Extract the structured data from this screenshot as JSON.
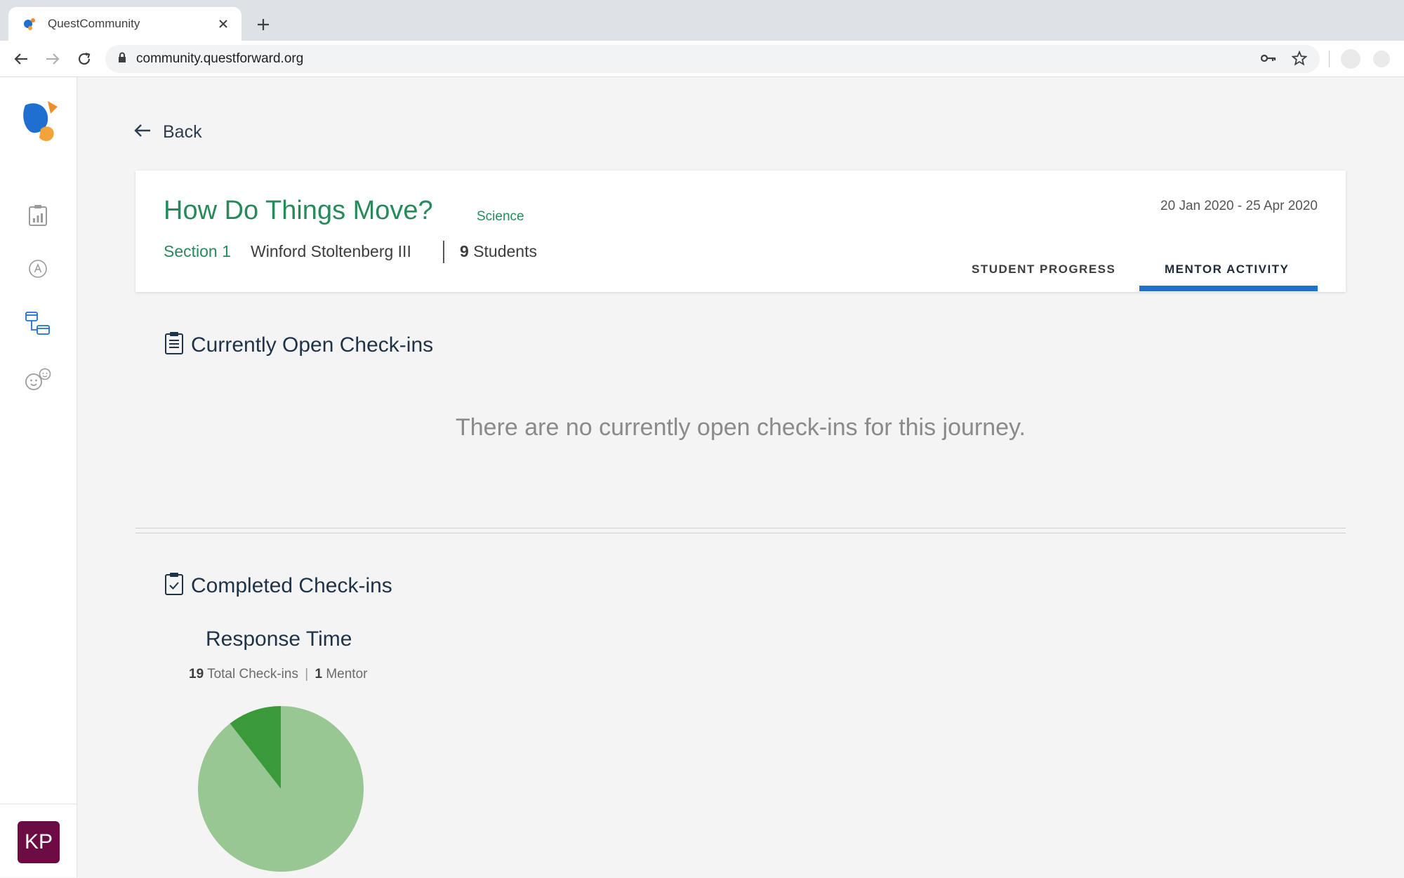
{
  "browser": {
    "tab_title": "QuestCommunity",
    "url": "community.questforward.org"
  },
  "sidebar": {
    "avatar_initials": "KP",
    "items": [
      {
        "icon": "report-icon"
      },
      {
        "icon": "badge-a-icon"
      },
      {
        "icon": "journeys-icon"
      },
      {
        "icon": "community-faces-icon"
      }
    ]
  },
  "page": {
    "back_label": "Back",
    "journey": {
      "title": "How Do Things Move?",
      "subject": "Science",
      "section": "Section 1",
      "teacher": "Winford Stoltenberg III",
      "students_count": "9",
      "students_label": "Students",
      "date_range": "20 Jan 2020 - 25 Apr 2020"
    },
    "tabs": [
      {
        "label": "STUDENT PROGRESS",
        "active": false
      },
      {
        "label": "MENTOR ACTIVITY",
        "active": true
      }
    ],
    "open_checkins": {
      "heading": "Currently Open Check-ins",
      "empty_message": "There are no currently open check-ins for this journey."
    },
    "completed_checkins": {
      "heading": "Completed Check-ins",
      "response_time_title": "Response Time",
      "total_count": "19",
      "total_label": "Total Check-ins",
      "separator": "|",
      "mentor_count": "1",
      "mentor_label": "Mentor"
    }
  },
  "colors": {
    "brand_green": "#278a5b",
    "tab_accent": "#1f6fd1",
    "pie_light": "#98c794",
    "pie_dark": "#3a9a3a",
    "avatar_bg": "#6d0b45"
  },
  "chart_data": {
    "type": "pie",
    "values": [
      2,
      17
    ],
    "colors": [
      "#3a9a3a",
      "#98c794"
    ]
  }
}
